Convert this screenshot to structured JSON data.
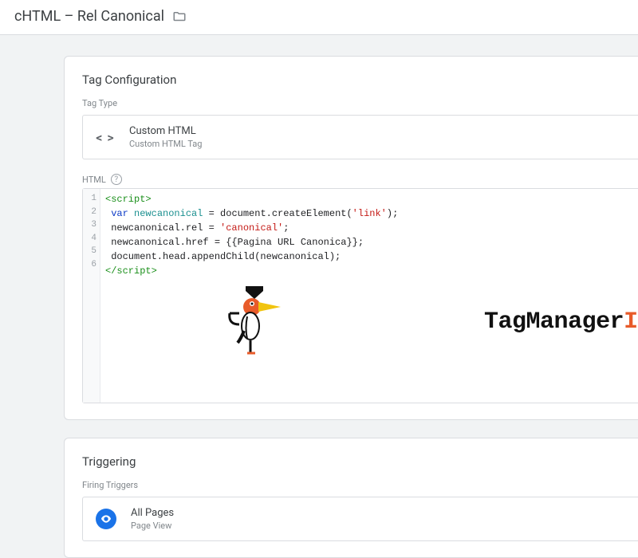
{
  "header": {
    "title": "cHTML – Rel Canonical"
  },
  "tag_config": {
    "card_title": "Tag Configuration",
    "type_label": "Tag Type",
    "type_name": "Custom HTML",
    "type_sub": "Custom HTML Tag",
    "html_label": "HTML",
    "code_lines": [
      "<script>",
      " var newcanonical = document.createElement('link');",
      " newcanonical.rel = 'canonical';",
      " newcanonical.href = {{Pagina URL Canonica}};",
      " document.head.appendChild(newcanonical);",
      "</script>"
    ],
    "line_numbers": [
      "1",
      "2",
      "3",
      "4",
      "5",
      "6"
    ]
  },
  "watermark": {
    "text_a": "TagManager",
    "text_b": "Italia"
  },
  "triggering": {
    "card_title": "Triggering",
    "section_label": "Firing Triggers",
    "trigger_name": "All Pages",
    "trigger_type": "Page View"
  }
}
